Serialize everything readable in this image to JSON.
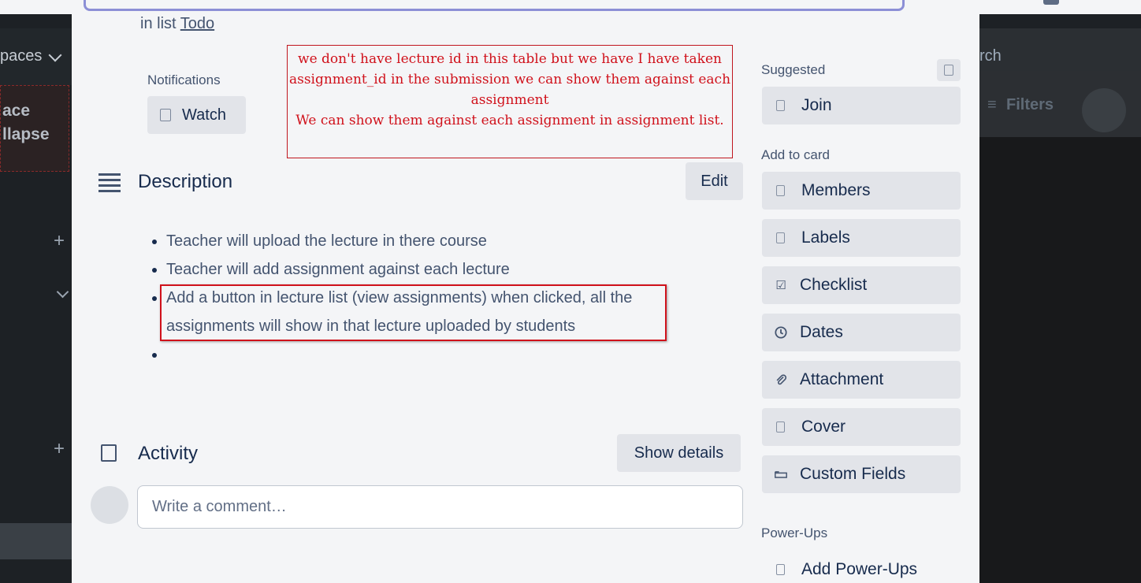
{
  "background": {
    "workspace_label": "paces",
    "collapse_line1": "ace",
    "collapse_line2": "llapse",
    "search_label": "rch",
    "filters_label": "Filters"
  },
  "card": {
    "in_list_prefix": "in list",
    "list_name": "Todo"
  },
  "notifications": {
    "label": "Notifications",
    "watch_label": "Watch"
  },
  "annotation": {
    "line1": "we don't have lecture id in this table but we have I have taken assignment_id in the submission we can show them against each assignment",
    "line2": "We can show them against each assignment in assignment list."
  },
  "description": {
    "title": "Description",
    "edit_label": "Edit",
    "items": [
      "Teacher will upload the lecture in there course",
      "Teacher will add assignment against each lecture",
      "Add a button in lecture list (view assignments) when clicked, all the assignments will show in that lecture uploaded by students",
      ""
    ]
  },
  "activity": {
    "title": "Activity",
    "show_details_label": "Show details",
    "comment_placeholder": "Write a comment…"
  },
  "sidebar": {
    "suggested_label": "Suggested",
    "join_label": "Join",
    "add_to_card_label": "Add to card",
    "buttons": [
      {
        "label": "Members",
        "icon": "member-icon"
      },
      {
        "label": "Labels",
        "icon": "label-icon"
      },
      {
        "label": "Checklist",
        "icon": "checklist-icon"
      },
      {
        "label": "Dates",
        "icon": "clock-icon"
      },
      {
        "label": "Attachment",
        "icon": "paperclip-icon"
      },
      {
        "label": "Cover",
        "icon": "cover-icon"
      },
      {
        "label": "Custom Fields",
        "icon": "custom-fields-icon"
      }
    ],
    "powerups_label": "Power-Ups",
    "add_powerups_label": "Add Power-Ups"
  },
  "colors": {
    "annotation_red": "#d0111b",
    "modal_bg": "#f4f5f7",
    "button_bg": "#e2e4e9",
    "text_primary": "#172b4d"
  }
}
